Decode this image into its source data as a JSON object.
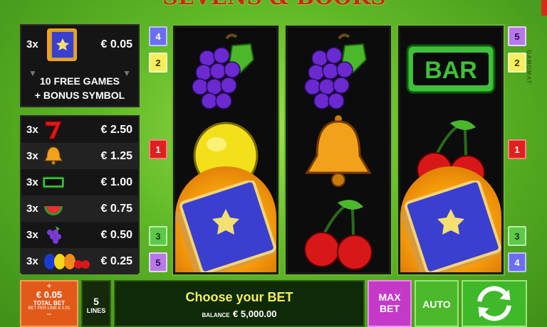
{
  "title": "SEVENS & BOOKS",
  "brand": "GAMOMAT",
  "colors": {
    "accent": "#6ab82c",
    "bet": "#e15a1a",
    "maxbet": "#c439c8",
    "auto": "#4ab82a"
  },
  "paytable": {
    "scatter": {
      "mult": "3x",
      "icon": "book-icon",
      "amount": "€ 0.05",
      "line1": "10 FREE GAMES",
      "line2": "+ BONUS SYMBOL"
    },
    "rows": [
      {
        "mult": "3x",
        "icon": "seven-icon",
        "amount": "€ 2.50"
      },
      {
        "mult": "3x",
        "icon": "bell-icon",
        "amount": "€ 1.25"
      },
      {
        "mult": "3x",
        "icon": "bar-icon",
        "amount": "€ 1.00"
      },
      {
        "mult": "3x",
        "icon": "watermelon-icon",
        "amount": "€ 0.75"
      },
      {
        "mult": "3x",
        "icon": "grapes-icon",
        "amount": "€ 0.50"
      },
      {
        "mult": "3x",
        "icon": "mixed-fruits-icon",
        "amount": "€ 0.25"
      }
    ]
  },
  "line_markers": {
    "left": [
      "4",
      "2",
      "1",
      "3",
      "5"
    ],
    "right": [
      "5",
      "2",
      "1",
      "3",
      "4"
    ]
  },
  "reels": [
    [
      "grapes-icon",
      "lemon-icon",
      "book-icon"
    ],
    [
      "grapes-icon",
      "bell-icon",
      "cherries-icon"
    ],
    [
      "bar-icon",
      "cherries-icon",
      "book-icon"
    ]
  ],
  "bar_label": "BAR",
  "controls": {
    "bet_plus": "+",
    "bet_value": "€ 0.05",
    "bet_label": "TOTAL BET",
    "bet_sub": "BET PER LINE € 0.01",
    "bet_minus": "−",
    "lines_value": "5",
    "lines_label": "LINES",
    "message": "Choose your BET",
    "balance_label": "BALANCE",
    "balance_value": "€ 5,000.00",
    "maxbet_line1": "MAX",
    "maxbet_line2": "BET",
    "auto_label": "AUTO"
  }
}
